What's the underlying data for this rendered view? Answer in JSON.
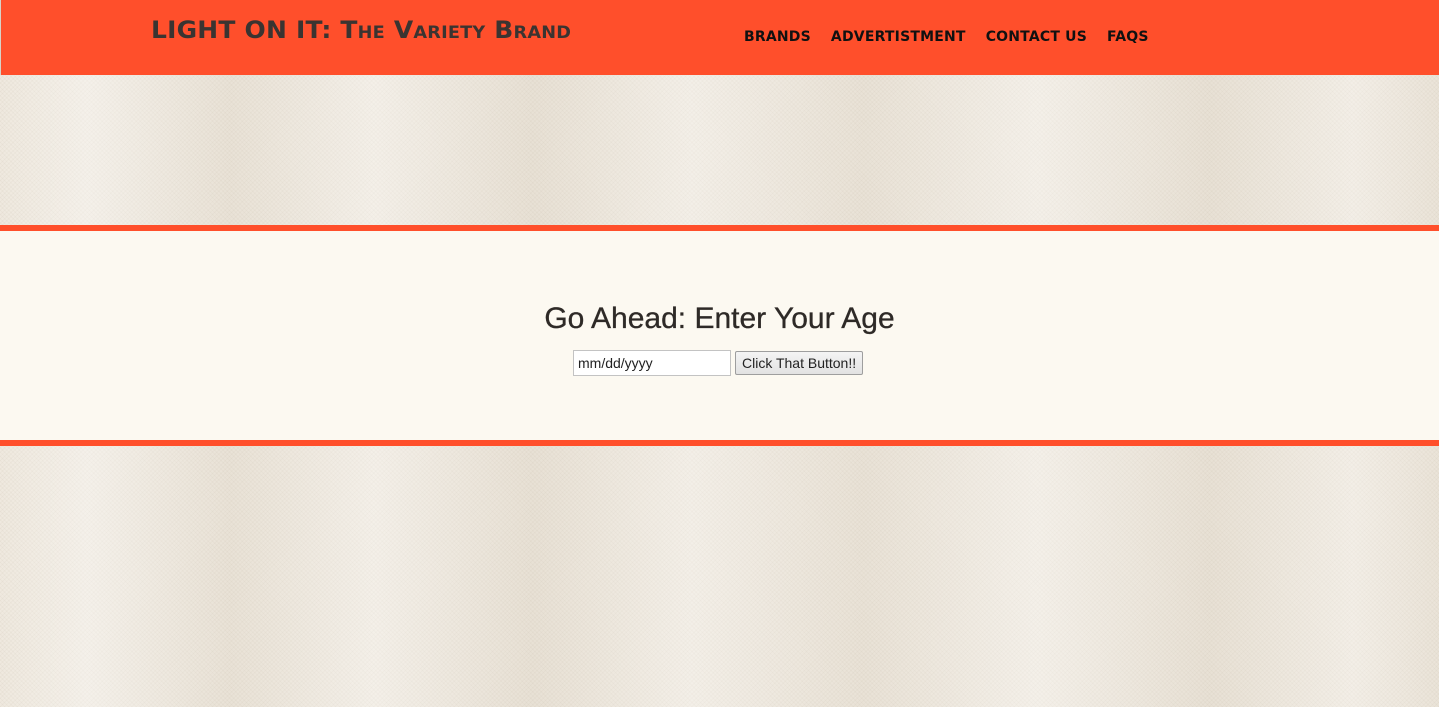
{
  "header": {
    "brand": "LIGHT ON IT: The Variety Brand",
    "nav": [
      {
        "label": "BRANDS"
      },
      {
        "label": "ADVERTISTMENT"
      },
      {
        "label": "CONTACT US"
      },
      {
        "label": "FAQS"
      }
    ]
  },
  "age_gate": {
    "title": "Go Ahead: Enter Your Age",
    "date_placeholder": "mm/dd/yyyy",
    "button_label": "Click That Button!!"
  },
  "colors": {
    "accent": "#ff4f2b",
    "band_background": "#fcf9f1",
    "text_dark": "#2e2a27"
  }
}
